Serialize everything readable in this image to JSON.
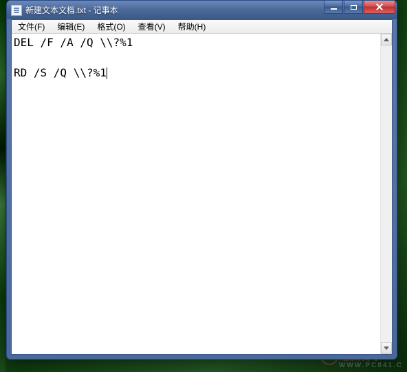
{
  "window": {
    "title": "新建文本文档.txt - 记事本"
  },
  "menu": {
    "file": "文件(F)",
    "edit": "编辑(E)",
    "format": "格式(O)",
    "view": "查看(V)",
    "help": "帮助(H)"
  },
  "editor": {
    "line1": "DEL /F /A /Q \\\\?%1",
    "blank": "",
    "line2": "RD /S /Q \\\\?%1"
  },
  "watermark": {
    "cn": "电脑百事",
    "en": "WWW.PC841.C"
  }
}
